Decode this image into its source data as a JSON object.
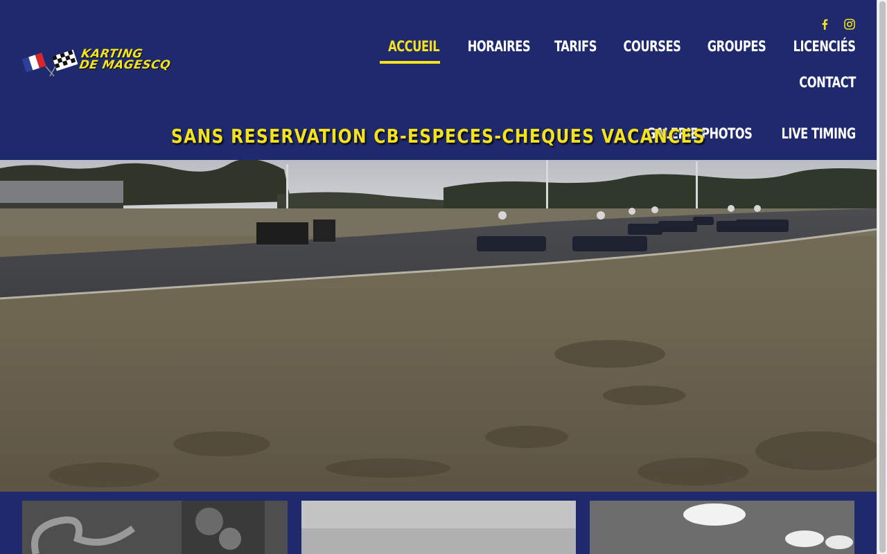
{
  "site": {
    "logo_alt": "Karting de Magescq",
    "logo_line1": "KARTING",
    "logo_line2": "DE MAGESCQ"
  },
  "social": [
    {
      "name": "facebook",
      "icon": "facebook-icon"
    },
    {
      "name": "instagram",
      "icon": "instagram-icon"
    }
  ],
  "nav": {
    "items": [
      {
        "label": "ACCUEIL",
        "active": true
      },
      {
        "label": "HORAIRES",
        "active": false
      },
      {
        "label": "TARIFS",
        "active": false
      },
      {
        "label": "COURSES",
        "active": false
      },
      {
        "label": "GROUPES",
        "active": false
      },
      {
        "label": "LICENCIÉS",
        "active": false
      },
      {
        "label": "CONTACT",
        "active": false
      },
      {
        "label": "GALERIE PHOTOS",
        "active": false
      },
      {
        "label": "LIVE TIMING",
        "active": false
      }
    ]
  },
  "tagline": "SANS RESERVATION CB-ESPECES-CHEQUES VACANCES",
  "colors": {
    "background": "#1f2a6e",
    "accent": "#f3e21d",
    "nav_text": "#ffffff"
  },
  "hero": {
    "description_icon": "karting-track-photo"
  },
  "cards": [
    {
      "icon": "aerial-track-photo"
    },
    {
      "icon": "sky-photo"
    },
    {
      "icon": "clouds-photo"
    }
  ]
}
